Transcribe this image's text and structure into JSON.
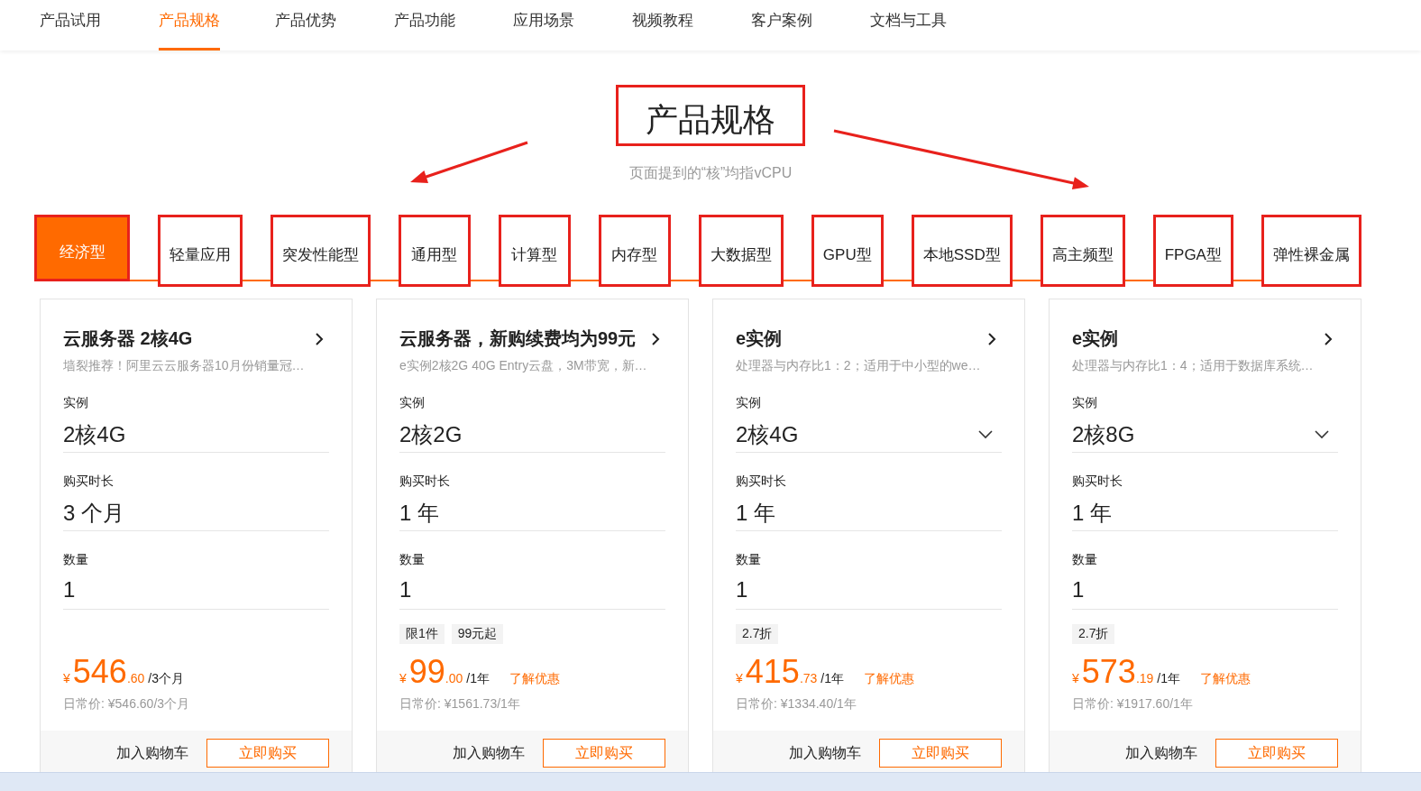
{
  "nav": [
    {
      "label": "产品试用",
      "selected": false
    },
    {
      "label": "产品规格",
      "selected": true
    },
    {
      "label": "产品优势",
      "selected": false
    },
    {
      "label": "产品功能",
      "selected": false
    },
    {
      "label": "应用场景",
      "selected": false
    },
    {
      "label": "视频教程",
      "selected": false
    },
    {
      "label": "客户案例",
      "selected": false
    },
    {
      "label": "文档与工具",
      "selected": false
    }
  ],
  "section": {
    "title": "产品规格",
    "subtitle": "页面提到的“核”均指vCPU"
  },
  "tabs": [
    {
      "label": "经济型",
      "selected": true
    },
    {
      "label": "轻量应用",
      "selected": false
    },
    {
      "label": "突发性能型",
      "selected": false
    },
    {
      "label": "通用型",
      "selected": false
    },
    {
      "label": "计算型",
      "selected": false
    },
    {
      "label": "内存型",
      "selected": false
    },
    {
      "label": "大数据型",
      "selected": false
    },
    {
      "label": "GPU型",
      "selected": false
    },
    {
      "label": "本地SSD型",
      "selected": false
    },
    {
      "label": "高主频型",
      "selected": false
    },
    {
      "label": "FPGA型",
      "selected": false
    },
    {
      "label": "弹性裸金属",
      "selected": false
    }
  ],
  "cards": [
    {
      "title": "云服务器 2核4G",
      "description": "墙裂推荐！阿里云云服务器10月份销量冠…",
      "fields": [
        {
          "label": "实例",
          "value": "2核4G",
          "dropdown": false
        },
        {
          "label": "购买时长",
          "value": "3 个月",
          "dropdown": false
        },
        {
          "label": "数量",
          "value": "1",
          "dropdown": false
        }
      ],
      "price": {
        "currency": "¥",
        "integer": "546",
        "decimal": ".60",
        "unit": "/3个月"
      },
      "regular_price": "日常价: ¥546.60/3个月",
      "buttons": [
        "加入购物车",
        "立即购买"
      ]
    },
    {
      "title": "云服务器，新购续费均为99元",
      "description": "e实例2核2G 40G Entry云盘，3M带宽，新…",
      "fields": [
        {
          "label": "实例",
          "value": "2核2G",
          "dropdown": false
        },
        {
          "label": "购买时长",
          "value": "1 年",
          "dropdown": false
        },
        {
          "label": "数量",
          "value": "1",
          "dropdown": false
        }
      ],
      "tags": [
        "限1件",
        "99元起"
      ],
      "price": {
        "currency": "¥",
        "integer": "99",
        "decimal": ".00",
        "unit": "/1年"
      },
      "promo_link": "了解优惠",
      "regular_price": "日常价: ¥1561.73/1年",
      "buttons": [
        "加入购物车",
        "立即购买"
      ]
    },
    {
      "title": "e实例",
      "description": "处理器与内存比1：2；适用于中小型的we…",
      "fields": [
        {
          "label": "实例",
          "value": "2核4G",
          "dropdown": true
        },
        {
          "label": "购买时长",
          "value": "1 年",
          "dropdown": false
        },
        {
          "label": "数量",
          "value": "1",
          "dropdown": false
        }
      ],
      "tags": [
        "2.7折"
      ],
      "price": {
        "currency": "¥",
        "integer": "415",
        "decimal": ".73",
        "unit": "/1年"
      },
      "promo_link": "了解优惠",
      "regular_price": "日常价: ¥1334.40/1年",
      "buttons": [
        "加入购物车",
        "立即购买"
      ]
    },
    {
      "title": "e实例",
      "description": "处理器与内存比1：4；适用于数据库系统…",
      "fields": [
        {
          "label": "实例",
          "value": "2核8G",
          "dropdown": true
        },
        {
          "label": "购买时长",
          "value": "1 年",
          "dropdown": false
        },
        {
          "label": "数量",
          "value": "1",
          "dropdown": false
        }
      ],
      "tags": [
        "2.7折"
      ],
      "price": {
        "currency": "¥",
        "integer": "573",
        "decimal": ".19",
        "unit": "/1年"
      },
      "promo_link": "了解优惠",
      "regular_price": "日常价: ¥1917.60/1年",
      "buttons": [
        "加入购物车",
        "立即购买"
      ]
    }
  ]
}
